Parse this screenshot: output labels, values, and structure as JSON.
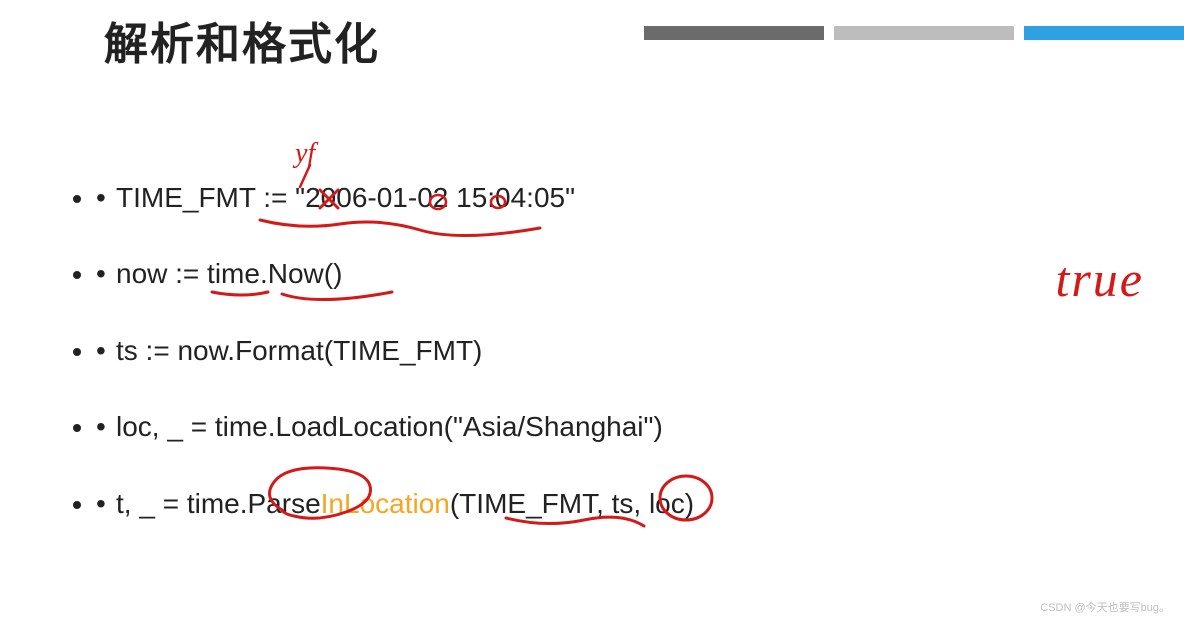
{
  "title": "解析和格式化",
  "bullets": {
    "b1_prefix": "TIME_FMT := \"",
    "b1_value": "2006-01-02 15:04:05",
    "b1_suffix": "\"",
    "b2": "now := time.Now()",
    "b3": "ts := now.Format(TIME_FMT)",
    "b4": "loc, _ = time.LoadLocation(\"Asia/Shanghai\")",
    "b5_prefix": "t, _ = time.Parse",
    "b5_orange": "InLocation",
    "b5_suffix": "(TIME_FMT, ts, loc)"
  },
  "annotations": {
    "hand_true": "true",
    "hand_yf": "yf"
  },
  "watermark": "CSDN @今天也要写bug。"
}
